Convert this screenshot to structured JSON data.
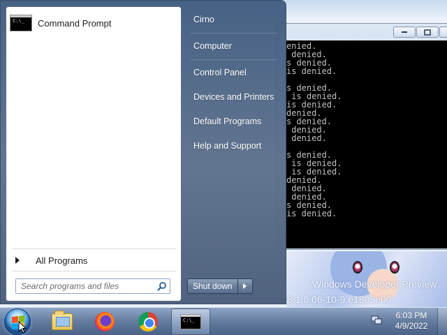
{
  "start_menu": {
    "pinned_programs": [
      {
        "label": "Command Prompt",
        "icon": "cmd-icon"
      }
    ],
    "all_programs_label": "All Programs",
    "search": {
      "placeholder": "Search programs and files"
    },
    "right_items": [
      {
        "label": "Cirno"
      },
      {
        "label": "Computer"
      },
      {
        "label": "Control Panel"
      },
      {
        "label": "Devices and Printers"
      },
      {
        "label": "Default Programs"
      },
      {
        "label": "Help and Support"
      }
    ],
    "shutdown_label": "Shut down"
  },
  "console": {
    "lines": [
      "enied.",
      " denied.",
      "s denied.",
      "is denied.",
      "",
      "s denied.",
      " is denied.",
      "is denied.",
      "denied.",
      "s denied.",
      " denied.",
      " denied.",
      "",
      "s denied.",
      " is denied.",
      " is denied.",
      "denied.",
      " denied.",
      " denied.",
      "s denied.",
      "is denied."
    ]
  },
  "desktop": {
    "watermark_line1": "Windows Developer Preview",
    "watermark_line2": "8.1.0.06-10-9.e1805e00"
  },
  "taskbar": {
    "apps": [
      {
        "name": "windows-explorer",
        "icon": "folder-icon"
      },
      {
        "name": "firefox",
        "icon": "firefox-icon"
      },
      {
        "name": "chrome",
        "icon": "chrome-icon"
      },
      {
        "name": "command-prompt",
        "icon": "cmd-icon",
        "active": true
      }
    ],
    "clock": {
      "time": "6:03 PM",
      "date": "4/9/2022"
    }
  }
}
